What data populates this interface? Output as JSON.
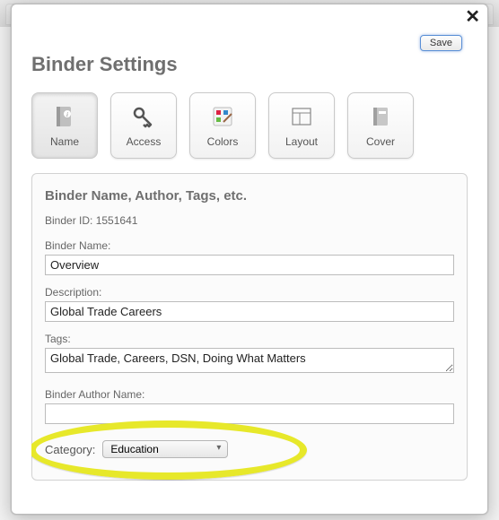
{
  "modal": {
    "title": "Binder Settings",
    "save_label": "Save"
  },
  "tabs": [
    {
      "label": "Name",
      "icon": "binder-info-icon"
    },
    {
      "label": "Access",
      "icon": "key-icon"
    },
    {
      "label": "Colors",
      "icon": "palette-icon"
    },
    {
      "label": "Layout",
      "icon": "layout-icon"
    },
    {
      "label": "Cover",
      "icon": "cover-icon"
    }
  ],
  "panel": {
    "heading": "Binder Name, Author, Tags, etc.",
    "id_label": "Binder ID:",
    "id_value": "1551641",
    "fields": {
      "name_label": "Binder Name:",
      "name_value": "Overview",
      "desc_label": "Description:",
      "desc_value": "Global Trade Careers",
      "tags_label": "Tags:",
      "tags_value": "Global Trade, Careers, DSN, Doing What Matters",
      "author_label": "Binder Author Name:",
      "author_value": ""
    },
    "category_label": "Category:",
    "category_value": "Education"
  }
}
